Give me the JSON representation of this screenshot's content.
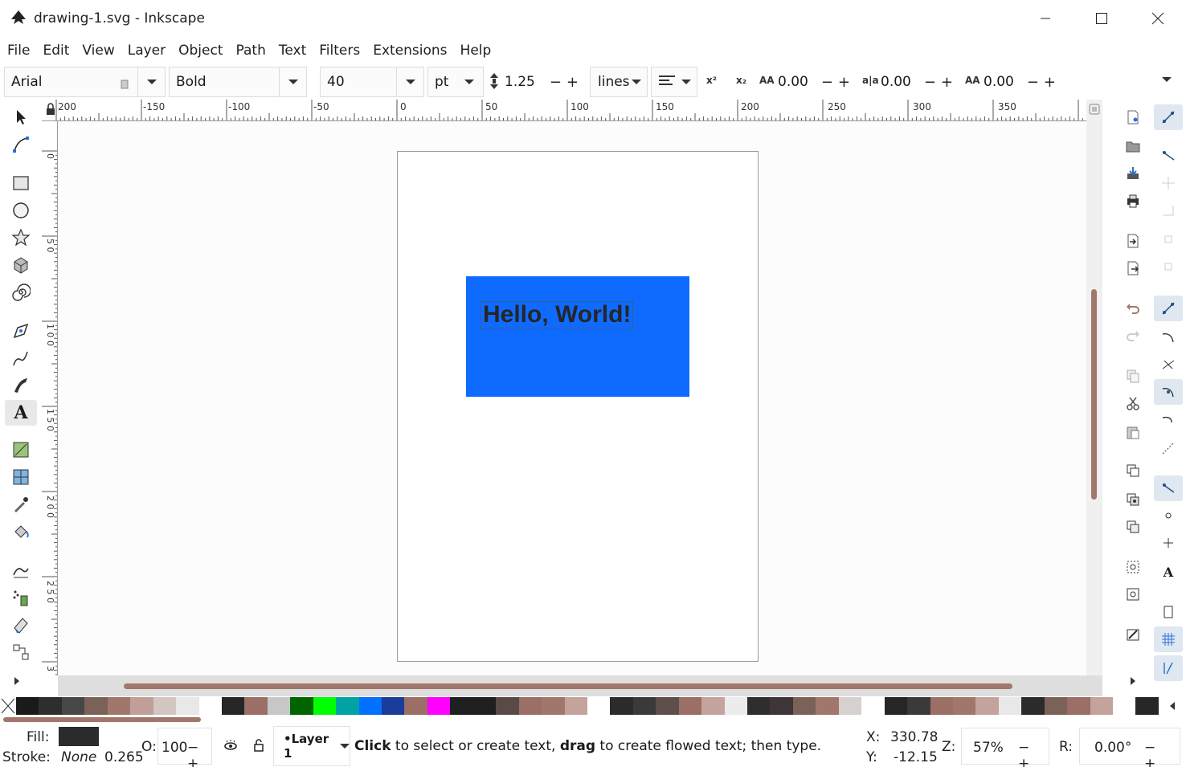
{
  "window": {
    "title": "drawing-1.svg - Inkscape"
  },
  "menu": [
    "File",
    "Edit",
    "View",
    "Layer",
    "Object",
    "Path",
    "Text",
    "Filters",
    "Extensions",
    "Help"
  ],
  "text_toolbar": {
    "font_family": "Arial",
    "font_style": "Bold",
    "font_size": "40",
    "unit": "pt",
    "line_spacing": "1.25",
    "spacing_mode": "lines",
    "letter_spacing": "0.00",
    "word_spacing": "0.00",
    "kerning": "0.00"
  },
  "rulers": {
    "horizontal": [
      "200",
      "-150",
      "-100",
      "-50",
      "0",
      "50",
      "100",
      "150",
      "200",
      "250",
      "300",
      "350"
    ],
    "vertical": [
      "0",
      "5 0",
      "1 0 0",
      "1 5 0",
      "2 0 0",
      "2 5 0",
      "3"
    ]
  },
  "canvas": {
    "text": "Hello, World!",
    "rect_color": "#0f6bff",
    "text_color": "#262626"
  },
  "colors": {
    "scrollbar_thumb": "#a1776c",
    "fill_swatch": "#2b2b2b",
    "palette": [
      "#1a1a1a",
      "#2e2e2e",
      "#474747",
      "#7a6259",
      "#a1776c",
      "#bf9f98",
      "#d3c5c0",
      "#e8e8e8",
      "#ffffff",
      "#262626",
      "#9b6e66",
      "#c7c7c7",
      "#006400",
      "#00ff00",
      "#00a3a3",
      "#0070ff",
      "#1a3d99",
      "#9b6e66",
      "#ff00ff",
      "#1f1f1f",
      "#1f1f1f",
      "#5a4a46",
      "#9b6e66",
      "#a1776c",
      "#c4a39d",
      "#ffffff",
      "#2b2b2b",
      "#3a3a3a",
      "#5e4f4b",
      "#9b6e66",
      "#c4a39d",
      "#ececec",
      "#2e2e2e",
      "#3d3536",
      "#7a6259",
      "#a1776c",
      "#d6d0cf",
      "#ffffff",
      "#262626",
      "#3a3a3a",
      "#9b6e66",
      "#a1776c",
      "#c4a39d",
      "#e8e8e8",
      "#2b2b2b",
      "#7a6259",
      "#9b6e66",
      "#c4a39d",
      "#ffffff",
      "#262626"
    ]
  },
  "status": {
    "fill_label": "Fill:",
    "stroke_label": "Stroke:",
    "stroke_value": "None",
    "stroke_width": "0.265",
    "opacity_label": "O:",
    "opacity_value": "100",
    "layer": "•Layer 1",
    "message_bold1": "Click",
    "message_mid": " to select or create text, ",
    "message_bold2": "drag",
    "message_end": " to create flowed text; then type.",
    "x_label": "X:",
    "x_value": "330.78",
    "y_label": "Y:",
    "y_value": "-12.15",
    "zoom_label": "Z:",
    "zoom_value": "57%",
    "rotation_label": "R:",
    "rotation_value": "0.00°"
  }
}
